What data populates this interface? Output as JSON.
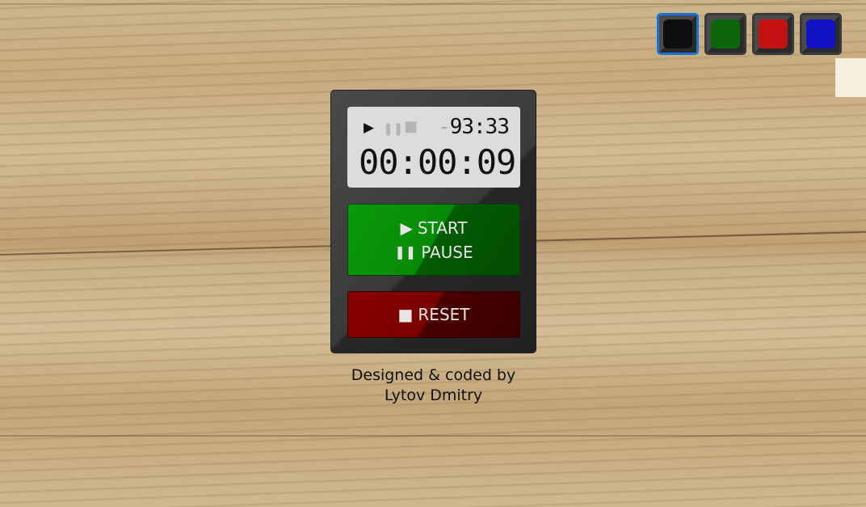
{
  "themes": [
    {
      "name": "black",
      "color": "#0e0e0e",
      "active": true
    },
    {
      "name": "green",
      "color": "#0c660c",
      "active": false
    },
    {
      "name": "red",
      "color": "#c41212",
      "active": false
    },
    {
      "name": "blue",
      "color": "#1212c4",
      "active": false
    }
  ],
  "display": {
    "status_icons": [
      "play-icon",
      "pause-icon",
      "stop-icon"
    ],
    "lap_sign": "-",
    "lap_time": "93:33",
    "time": "00:00:09"
  },
  "buttons": {
    "start": "START",
    "pause": "PAUSE",
    "reset": "RESET"
  },
  "credit": {
    "line1": "Designed & coded by",
    "line2": "Lytov Dmitry"
  }
}
